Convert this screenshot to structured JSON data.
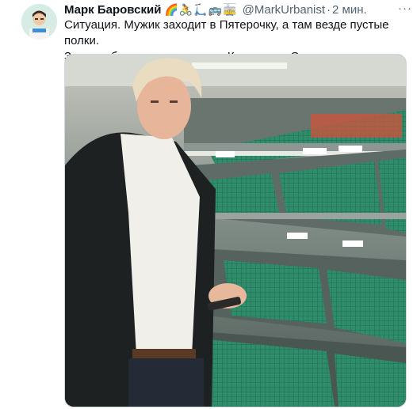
{
  "tweet": {
    "author_name": "Марк Баровский",
    "author_emojis": "🌈🚴🛴🚌🚋",
    "handle": "@MarkUrbanist",
    "separator": "·",
    "time": "2 мин.",
    "more_label": "···",
    "text_line1": "Ситуация. Мужик заходит в Пятерочку, а там везде пустые полки.",
    "text_line2": "Зато стабильность, скрепы и Крым наш. Сэдли"
  },
  "colors": {
    "text": "#0f1419",
    "secondary": "#536471",
    "crate_green": "#2e8a6a"
  }
}
